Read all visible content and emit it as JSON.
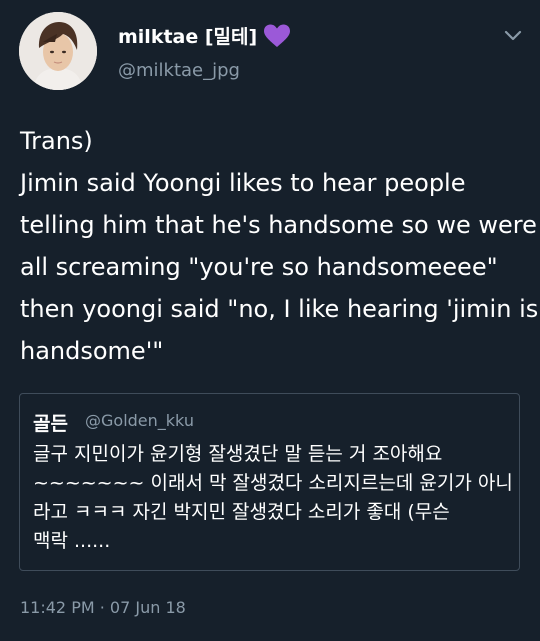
{
  "author": {
    "display_name": "milktae [밀테]",
    "handle": "@milktae_jpg",
    "badge_icon": "purple-heart-icon",
    "badge_color": "#9b59d8"
  },
  "tweet": {
    "lines": [
      "Trans)",
      "Jimin said Yoongi likes to hear people",
      "telling him that he's handsome so we were",
      "all screaming \"you're so handsomeeee\"",
      "then yoongi said \"no, I like hearing 'jimin is",
      "handsome'\""
    ],
    "timestamp": "11:42 PM · 07 Jun 18"
  },
  "quoted_tweet": {
    "display_name": "골든",
    "handle": "@Golden_kku",
    "lines": [
      "글구 지민이가 윤기형 잘생겼단 말 듣는 거 조아해요",
      "~~~~~~~ 이래서 막 잘생겼다 소리지르는데 윤기가 아니",
      "라고 ㅋㅋㅋ 자긴 박지민 잘생겼다 소리가 좋대 (무슨",
      "맥락 ......"
    ]
  },
  "colors": {
    "background": "#16202b",
    "text": "#ffffff",
    "secondary_text": "#8a9aa8",
    "card_border": "#3f4c5a"
  }
}
